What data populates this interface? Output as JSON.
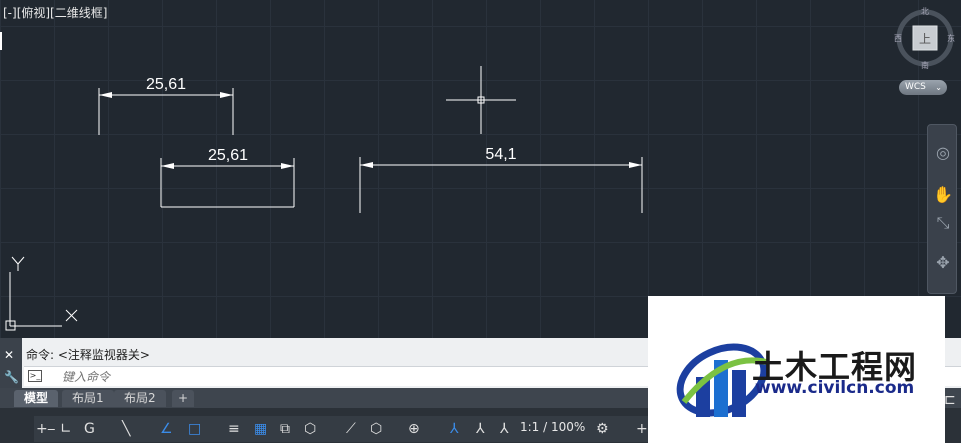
{
  "viewport": {
    "label": "[-][俯视][二维线框]"
  },
  "drawing": {
    "dimensions": [
      {
        "text": "25,61"
      },
      {
        "text": "25,61"
      },
      {
        "text": "54,1"
      }
    ],
    "ucs": {
      "x_label": "X",
      "y_label": "Y"
    }
  },
  "viewcube": {
    "north": "北",
    "south": "南",
    "east": "东",
    "west": "西",
    "face": "上",
    "wcs": "WCS"
  },
  "navbar": {
    "items": [
      "steering-wheel-icon",
      "pan-icon",
      "zoom-icon",
      "orbit-icon"
    ]
  },
  "command": {
    "history": "命令: <注释监视器关>",
    "placeholder": "键入命令",
    "close": "✕",
    "wrench": "🔧"
  },
  "tabs": [
    {
      "label": "模型",
      "active": true
    },
    {
      "label": "布局1",
      "active": false
    },
    {
      "label": "布局2",
      "active": false
    },
    {
      "label": "+",
      "active": false
    }
  ],
  "statusbar": {
    "scale": "1:1 / 100%",
    "accent": "#3b8ce8"
  },
  "watermark": {
    "title": "土木工程网",
    "url": "www.civilcn.com"
  }
}
